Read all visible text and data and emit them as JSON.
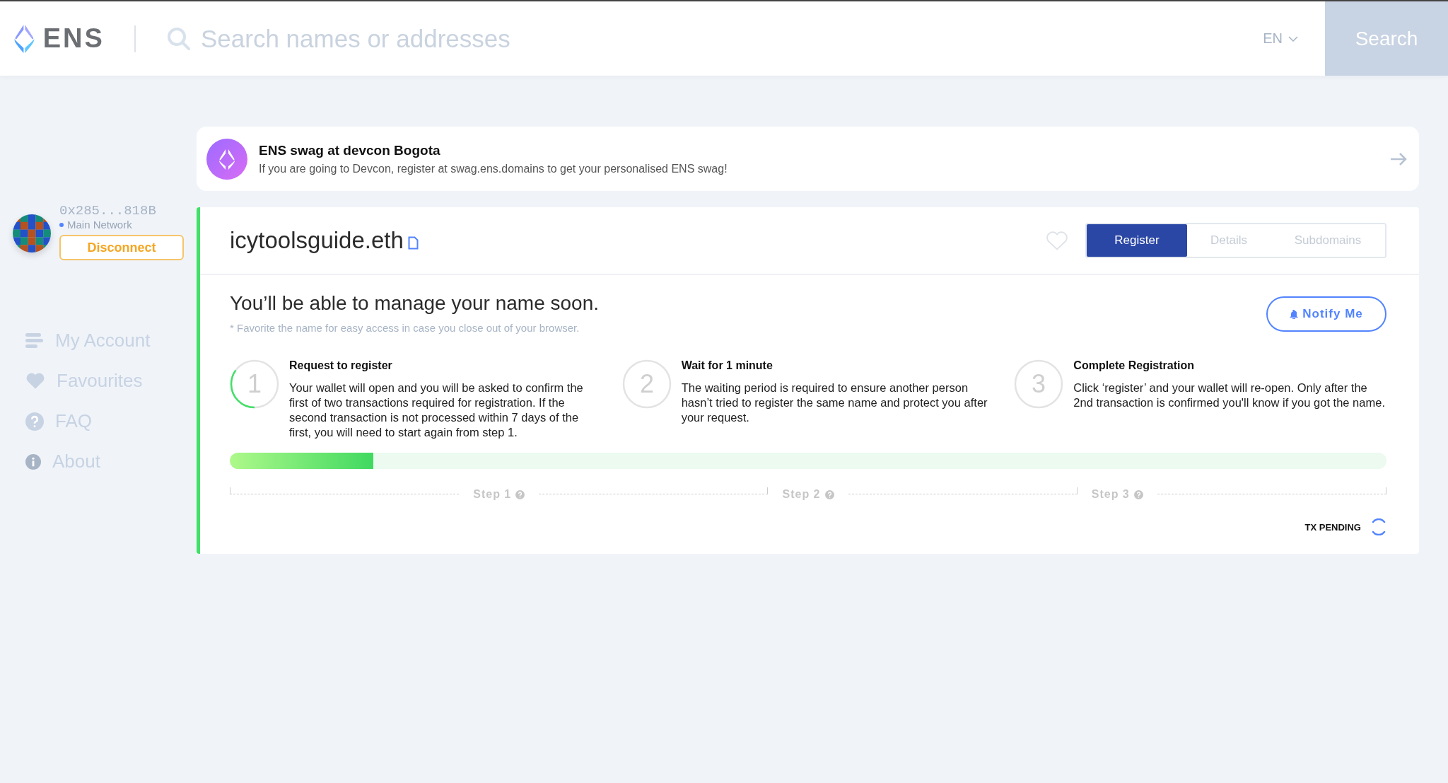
{
  "header": {
    "logo": "ENS",
    "search": {
      "placeholder": "Search names or addresses"
    },
    "language": "EN",
    "search_button": "Search"
  },
  "account": {
    "address": "0x285...818B",
    "network": "Main Network",
    "disconnect": "Disconnect"
  },
  "sidebar": {
    "items": [
      {
        "label": "My Account",
        "selected": false
      },
      {
        "label": "Favourites",
        "selected": false
      },
      {
        "label": "FAQ",
        "selected": false
      },
      {
        "label": "About",
        "selected": false
      }
    ]
  },
  "banner": {
    "title": "ENS swag at devcon Bogota",
    "text": "If you are going to Devcon, register at swag.ens.domains to get your personalised ENS swag!"
  },
  "name_card": {
    "name": "icytoolsguide.eth",
    "favourite": false,
    "tabs": [
      {
        "label": "Register",
        "selected": true
      },
      {
        "label": "Details",
        "selected": false
      },
      {
        "label": "Subdomains",
        "selected": false
      }
    ],
    "heading": "You’ll be able to manage your name soon.",
    "note": "* Favorite the name for easy access in case you close out of your browser.",
    "notify_button": "Notify Me",
    "steps": [
      {
        "number": "1",
        "title": "Request to register",
        "text": "Your wallet will open and you will be asked to confirm the first of two transactions required for registration. If the second transaction is not processed within 7 days of the first, you will need to start again from step 1.",
        "active": true
      },
      {
        "number": "2",
        "title": "Wait for 1 minute",
        "text": "The waiting period is required to ensure another person hasn’t tried to register the same name and protect you after your request.",
        "active": false
      },
      {
        "number": "3",
        "title": "Complete Registration",
        "text": "Click ‘register’ and your wallet will re-open. Only after the 2nd transaction is confirmed you'll know if you got the name.",
        "active": false
      }
    ],
    "progress": {
      "level": 0.124
    },
    "timeline": [
      "Step 1",
      "Step 2",
      "Step 3"
    ],
    "status": "TX PENDING"
  }
}
